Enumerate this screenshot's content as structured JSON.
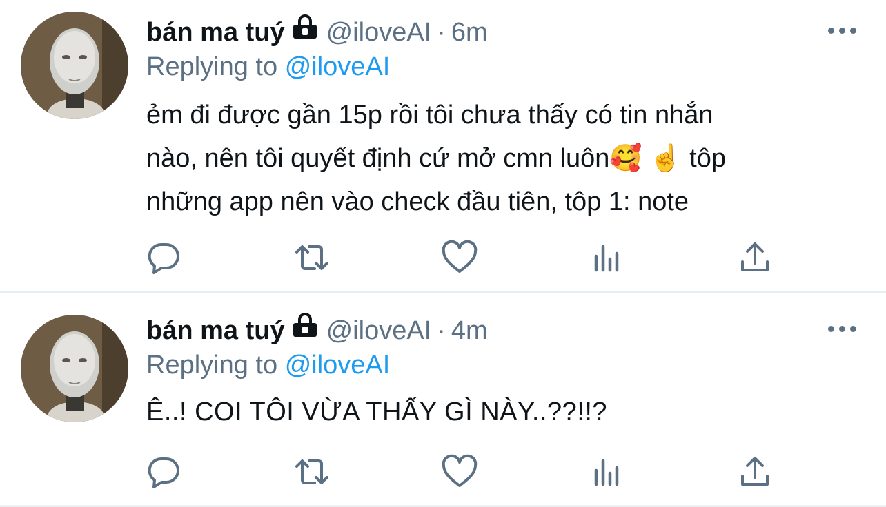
{
  "tweets": [
    {
      "display_name": "bán ma tuý",
      "handle": "@iloveAI",
      "separator": "·",
      "time": "6m",
      "replying_prefix": "Replying to",
      "replying_handle": "@iloveAI",
      "text_lines": [
        "ẻm đi được gần 15p rồi tôi chưa thấy có tin nhắn",
        "nào, nên tôi quyết định cứ mở cmn luôn🥰 ☝️  tôp",
        "những app nên vào check đầu tiên, tôp 1: note"
      ]
    },
    {
      "display_name": "bán ma tuý",
      "handle": "@iloveAI",
      "separator": "·",
      "time": "4m",
      "replying_prefix": "Replying to",
      "replying_handle": "@iloveAI",
      "text_lines": [
        "Ê..! COI TÔI VỪA THẤY GÌ NÀY..??!!?"
      ]
    }
  ],
  "icons": {
    "lock": "lock-icon",
    "more": "more-icon",
    "reply": "reply-icon",
    "retweet": "retweet-icon",
    "like": "like-icon",
    "analytics": "analytics-icon",
    "share": "share-icon"
  },
  "colors": {
    "link": "#1d9bf0",
    "secondary_text": "#5b7083",
    "divider": "#e6ecf0"
  }
}
